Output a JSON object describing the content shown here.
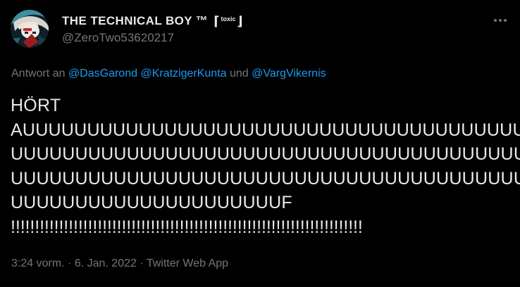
{
  "author": {
    "display_name": "THE TECHNICAL BOY ™",
    "badge_open": "⌈",
    "badge_text": "toxic",
    "badge_close": "⌋",
    "handle": "@ZeroTwo53620217",
    "avatar_icon": "anime-avatar-icon"
  },
  "menu": {
    "icon": "more-horizontal-icon"
  },
  "reply": {
    "prefix": "Antwort an",
    "mention_1": "@DasGarond",
    "mention_2": "@KratzigerKunta",
    "conjunction": "und",
    "mention_3": "@VargVikernis"
  },
  "tweet": {
    "lines": [
      "HÖRT",
      "AUUUUUUUUUUUUUUUUUUUUUUUUUUUUUUUUUUUUUUU",
      "UUUUUUUUUUUUUUUUUUUUUUUUUUUUUUUUUUUUUUUU",
      "UUUUUUUUUUUUUUUUUUUUUUUUUUUUUUUUUUUUUUUU",
      "UUUUUUUUUUUUUUUUUUUUUF",
      "!!!!!!!!!!!!!!!!!!!!!!!!!!!!!!!!!!!!!!!!!!!!!!!!!!!!!!!!!!!!!!!!!!!!!!!!!"
    ]
  },
  "meta": {
    "time": "3:24 vorm.",
    "separator": "·",
    "date": "6. Jan. 2022",
    "source": "Twitter Web App"
  },
  "colors": {
    "background": "#000000",
    "text": "#e7e9ea",
    "secondary": "#71767b",
    "link": "#1d9bf0"
  }
}
